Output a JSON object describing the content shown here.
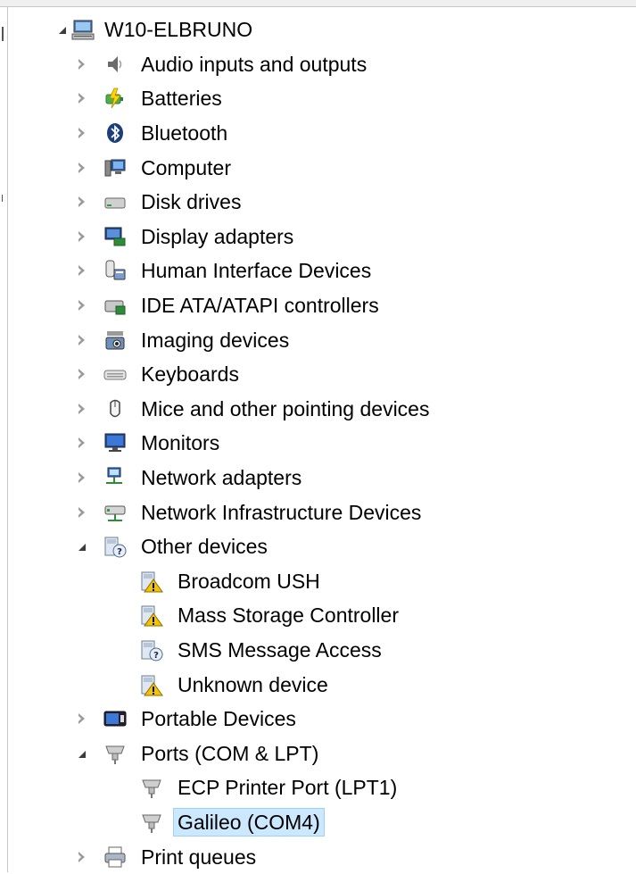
{
  "tree": {
    "root": {
      "label": "W10-ELBRUNO",
      "icon": "computer-network-icon",
      "expanded": true
    },
    "categories": [
      {
        "label": "Audio inputs and outputs",
        "icon": "speaker-icon",
        "expanded": false
      },
      {
        "label": "Batteries",
        "icon": "battery-icon",
        "expanded": false
      },
      {
        "label": "Bluetooth",
        "icon": "bluetooth-icon",
        "expanded": false
      },
      {
        "label": "Computer",
        "icon": "computer-icon",
        "expanded": false
      },
      {
        "label": "Disk drives",
        "icon": "disk-drive-icon",
        "expanded": false
      },
      {
        "label": "Display adapters",
        "icon": "display-adapter-icon",
        "expanded": false
      },
      {
        "label": "Human Interface Devices",
        "icon": "hid-icon",
        "expanded": false
      },
      {
        "label": "IDE ATA/ATAPI controllers",
        "icon": "ide-controller-icon",
        "expanded": false
      },
      {
        "label": "Imaging devices",
        "icon": "camera-icon",
        "expanded": false
      },
      {
        "label": "Keyboards",
        "icon": "keyboard-icon",
        "expanded": false
      },
      {
        "label": "Mice and other pointing devices",
        "icon": "mouse-icon",
        "expanded": false
      },
      {
        "label": "Monitors",
        "icon": "monitor-icon",
        "expanded": false
      },
      {
        "label": "Network adapters",
        "icon": "network-adapter-icon",
        "expanded": false
      },
      {
        "label": "Network Infrastructure Devices",
        "icon": "network-infrastructure-icon",
        "expanded": false
      },
      {
        "label": "Other devices",
        "icon": "unknown-device-icon",
        "expanded": true,
        "children": [
          {
            "label": "Broadcom USH",
            "icon": "device-warning-icon"
          },
          {
            "label": "Mass Storage Controller",
            "icon": "device-warning-icon"
          },
          {
            "label": "SMS Message Access",
            "icon": "unknown-device-icon"
          },
          {
            "label": "Unknown device",
            "icon": "device-warning-icon"
          }
        ]
      },
      {
        "label": "Portable Devices",
        "icon": "portable-device-icon",
        "expanded": false
      },
      {
        "label": "Ports (COM & LPT)",
        "icon": "port-connector-icon",
        "expanded": true,
        "children": [
          {
            "label": "ECP Printer Port (LPT1)",
            "icon": "port-connector-icon",
            "selected": false
          },
          {
            "label": "Galileo (COM4)",
            "icon": "port-connector-icon",
            "selected": true
          }
        ]
      },
      {
        "label": "Print queues",
        "icon": "printer-icon",
        "expanded": false
      }
    ]
  },
  "colors": {
    "selection_fill": "#cce8ff",
    "selection_border": "#99d1ff",
    "warning_yellow": "#f5c400"
  }
}
